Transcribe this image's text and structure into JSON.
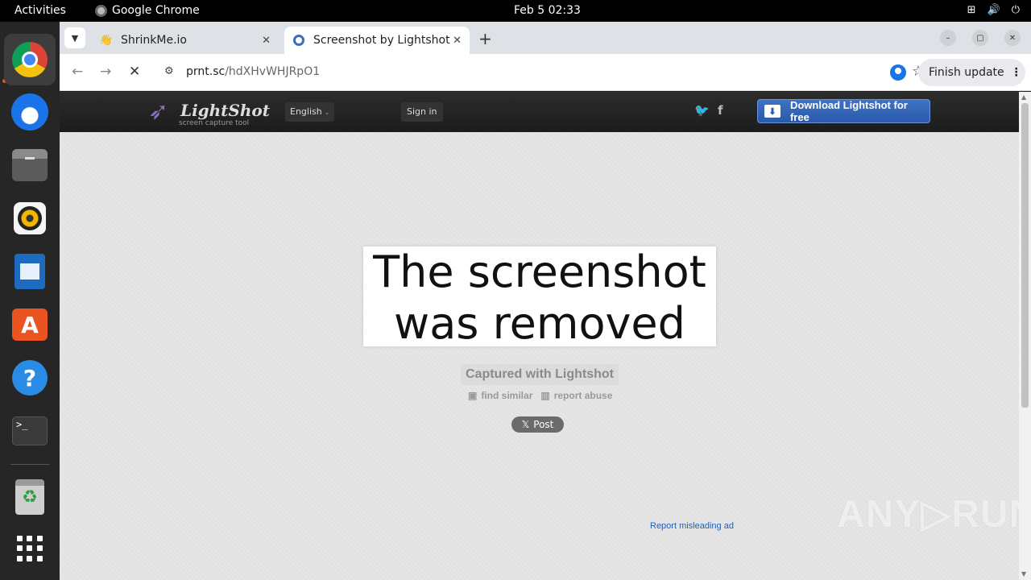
{
  "system": {
    "activities": "Activities",
    "app_name": "Google Chrome",
    "clock": "Feb 5  02:33"
  },
  "dock": {
    "items": [
      "Google Chrome",
      "Thunderbird Mail",
      "Files",
      "Rhythmbox",
      "LibreOffice Writer",
      "Ubuntu Software",
      "Help",
      "Terminal",
      "Trash",
      "Show Applications"
    ],
    "terminal_prompt": ">_",
    "store_glyph": "A",
    "help_glyph": "?",
    "trash_glyph": "♻"
  },
  "browser": {
    "tabs": [
      {
        "title": "ShrinkMe.io",
        "favicon": "hand-icon"
      },
      {
        "title": "Screenshot by Lightshot",
        "favicon": "lightshot-icon",
        "active": true
      }
    ],
    "url_host": "prnt.sc",
    "url_path": "/hdXHvWHJRpO1",
    "finish_update": "Finish update"
  },
  "page": {
    "logo_name": "LightShot",
    "logo_tagline": "screen capture tool",
    "language": "English",
    "sign_in": "Sign in",
    "download_label": "Download Lightshot for free",
    "removed_line1": "The screenshot",
    "removed_line2": "was removed",
    "captured": "Captured with Lightshot",
    "find_similar": "find similar",
    "report_abuse": "report abuse",
    "x_post": "Post",
    "report_ad": "Report misleading ad",
    "watermark": "ANY▷RUN"
  },
  "colors": {
    "accent": "#e95420",
    "download_button": "#2a5aa8",
    "link": "#2162b4"
  }
}
